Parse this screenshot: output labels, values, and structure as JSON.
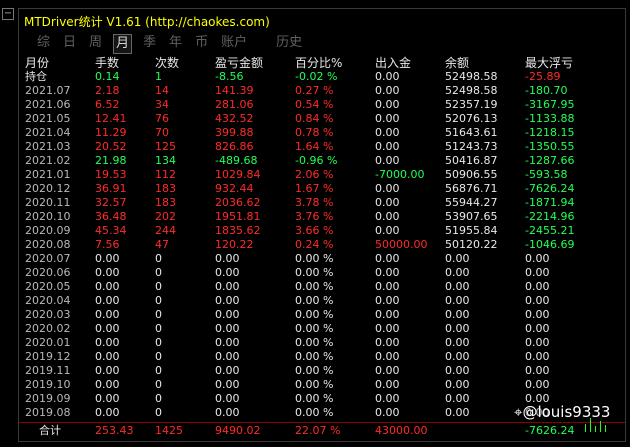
{
  "sidebar": {
    "collapse_label": "−"
  },
  "header": {
    "title": "MTDriver统计 V1.61  (http://chaokes.com)"
  },
  "tabs": [
    {
      "label": "综"
    },
    {
      "label": "日"
    },
    {
      "label": "周"
    },
    {
      "label": "月"
    },
    {
      "label": "季"
    },
    {
      "label": "年"
    },
    {
      "label": "币"
    },
    {
      "label": "账户"
    },
    {
      "label": "历史"
    }
  ],
  "active_tab": "月",
  "columns": [
    "月份",
    "手数",
    "次数",
    "盈亏金额",
    "百分比%",
    "出入金",
    "余额",
    "最大浮亏"
  ],
  "holding": {
    "label": "持仓",
    "lots": "0.14",
    "count": "1",
    "pnl": "-8.56",
    "pct": "-0.02 %",
    "flow": "0.00",
    "balance": "52498.58",
    "maxdd": "-25.89"
  },
  "rows": [
    {
      "month": "2021.07",
      "lots": "2.18",
      "count": "14",
      "pnl": "141.39",
      "pct": "0.27 %",
      "flow": "0.00",
      "balance": "52498.58",
      "maxdd": "-180.70"
    },
    {
      "month": "2021.06",
      "lots": "6.52",
      "count": "34",
      "pnl": "281.06",
      "pct": "0.54 %",
      "flow": "0.00",
      "balance": "52357.19",
      "maxdd": "-3167.95"
    },
    {
      "month": "2021.05",
      "lots": "12.41",
      "count": "76",
      "pnl": "432.52",
      "pct": "0.84 %",
      "flow": "0.00",
      "balance": "52076.13",
      "maxdd": "-1133.88"
    },
    {
      "month": "2021.04",
      "lots": "11.29",
      "count": "70",
      "pnl": "399.88",
      "pct": "0.78 %",
      "flow": "0.00",
      "balance": "51643.61",
      "maxdd": "-1218.15"
    },
    {
      "month": "2021.03",
      "lots": "20.52",
      "count": "125",
      "pnl": "826.86",
      "pct": "1.64 %",
      "flow": "0.00",
      "balance": "51243.73",
      "maxdd": "-1350.55"
    },
    {
      "month": "2021.02",
      "lots": "21.98",
      "count": "134",
      "pnl": "-489.68",
      "pct": "-0.96 %",
      "flow": "0.00",
      "balance": "50416.87",
      "maxdd": "-1287.66"
    },
    {
      "month": "2021.01",
      "lots": "19.53",
      "count": "112",
      "pnl": "1029.84",
      "pct": "2.06 %",
      "flow": "-7000.00",
      "balance": "50906.55",
      "maxdd": "-593.58"
    },
    {
      "month": "2020.12",
      "lots": "36.91",
      "count": "183",
      "pnl": "932.44",
      "pct": "1.67 %",
      "flow": "0.00",
      "balance": "56876.71",
      "maxdd": "-7626.24"
    },
    {
      "month": "2020.11",
      "lots": "32.57",
      "count": "183",
      "pnl": "2036.62",
      "pct": "3.78 %",
      "flow": "0.00",
      "balance": "55944.27",
      "maxdd": "-1871.94"
    },
    {
      "month": "2020.10",
      "lots": "36.48",
      "count": "202",
      "pnl": "1951.81",
      "pct": "3.76 %",
      "flow": "0.00",
      "balance": "53907.65",
      "maxdd": "-2214.96"
    },
    {
      "month": "2020.09",
      "lots": "45.34",
      "count": "244",
      "pnl": "1835.62",
      "pct": "3.66 %",
      "flow": "0.00",
      "balance": "51955.84",
      "maxdd": "-2455.21"
    },
    {
      "month": "2020.08",
      "lots": "7.56",
      "count": "47",
      "pnl": "120.22",
      "pct": "0.24 %",
      "flow": "50000.00",
      "balance": "50120.22",
      "maxdd": "-1046.69"
    },
    {
      "month": "2020.07",
      "lots": "0.00",
      "count": "0",
      "pnl": "0.00",
      "pct": "0.00 %",
      "flow": "0.00",
      "balance": "0.00",
      "maxdd": "0.00"
    },
    {
      "month": "2020.06",
      "lots": "0.00",
      "count": "0",
      "pnl": "0.00",
      "pct": "0.00 %",
      "flow": "0.00",
      "balance": "0.00",
      "maxdd": "0.00"
    },
    {
      "month": "2020.05",
      "lots": "0.00",
      "count": "0",
      "pnl": "0.00",
      "pct": "0.00 %",
      "flow": "0.00",
      "balance": "0.00",
      "maxdd": "0.00"
    },
    {
      "month": "2020.04",
      "lots": "0.00",
      "count": "0",
      "pnl": "0.00",
      "pct": "0.00 %",
      "flow": "0.00",
      "balance": "0.00",
      "maxdd": "0.00"
    },
    {
      "month": "2020.03",
      "lots": "0.00",
      "count": "0",
      "pnl": "0.00",
      "pct": "0.00 %",
      "flow": "0.00",
      "balance": "0.00",
      "maxdd": "0.00"
    },
    {
      "month": "2020.02",
      "lots": "0.00",
      "count": "0",
      "pnl": "0.00",
      "pct": "0.00 %",
      "flow": "0.00",
      "balance": "0.00",
      "maxdd": "0.00"
    },
    {
      "month": "2020.01",
      "lots": "0.00",
      "count": "0",
      "pnl": "0.00",
      "pct": "0.00 %",
      "flow": "0.00",
      "balance": "0.00",
      "maxdd": "0.00"
    },
    {
      "month": "2019.12",
      "lots": "0.00",
      "count": "0",
      "pnl": "0.00",
      "pct": "0.00 %",
      "flow": "0.00",
      "balance": "0.00",
      "maxdd": "0.00"
    },
    {
      "month": "2019.11",
      "lots": "0.00",
      "count": "0",
      "pnl": "0.00",
      "pct": "0.00 %",
      "flow": "0.00",
      "balance": "0.00",
      "maxdd": "0.00"
    },
    {
      "month": "2019.10",
      "lots": "0.00",
      "count": "0",
      "pnl": "0.00",
      "pct": "0.00 %",
      "flow": "0.00",
      "balance": "0.00",
      "maxdd": "0.00"
    },
    {
      "month": "2019.09",
      "lots": "0.00",
      "count": "0",
      "pnl": "0.00",
      "pct": "0.00 %",
      "flow": "0.00",
      "balance": "0.00",
      "maxdd": "0.00"
    },
    {
      "month": "2019.08",
      "lots": "0.00",
      "count": "0",
      "pnl": "0.00",
      "pct": "0.00 %",
      "flow": "0.00",
      "balance": "0.00",
      "maxdd": "0.00"
    }
  ],
  "total": {
    "label": "合计",
    "lots": "253.43",
    "count": "1425",
    "pnl": "9490.02",
    "pct": "22.07 %",
    "flow": "43000.00",
    "maxdd": "-7626.24"
  },
  "watermark": {
    "icon": "social-logo-icon",
    "text": "@louis9333"
  },
  "colors": {
    "title": "#ffff00",
    "positive": "#ff2a2a",
    "negative": "#22ff55",
    "header": "#e8e8e8"
  }
}
